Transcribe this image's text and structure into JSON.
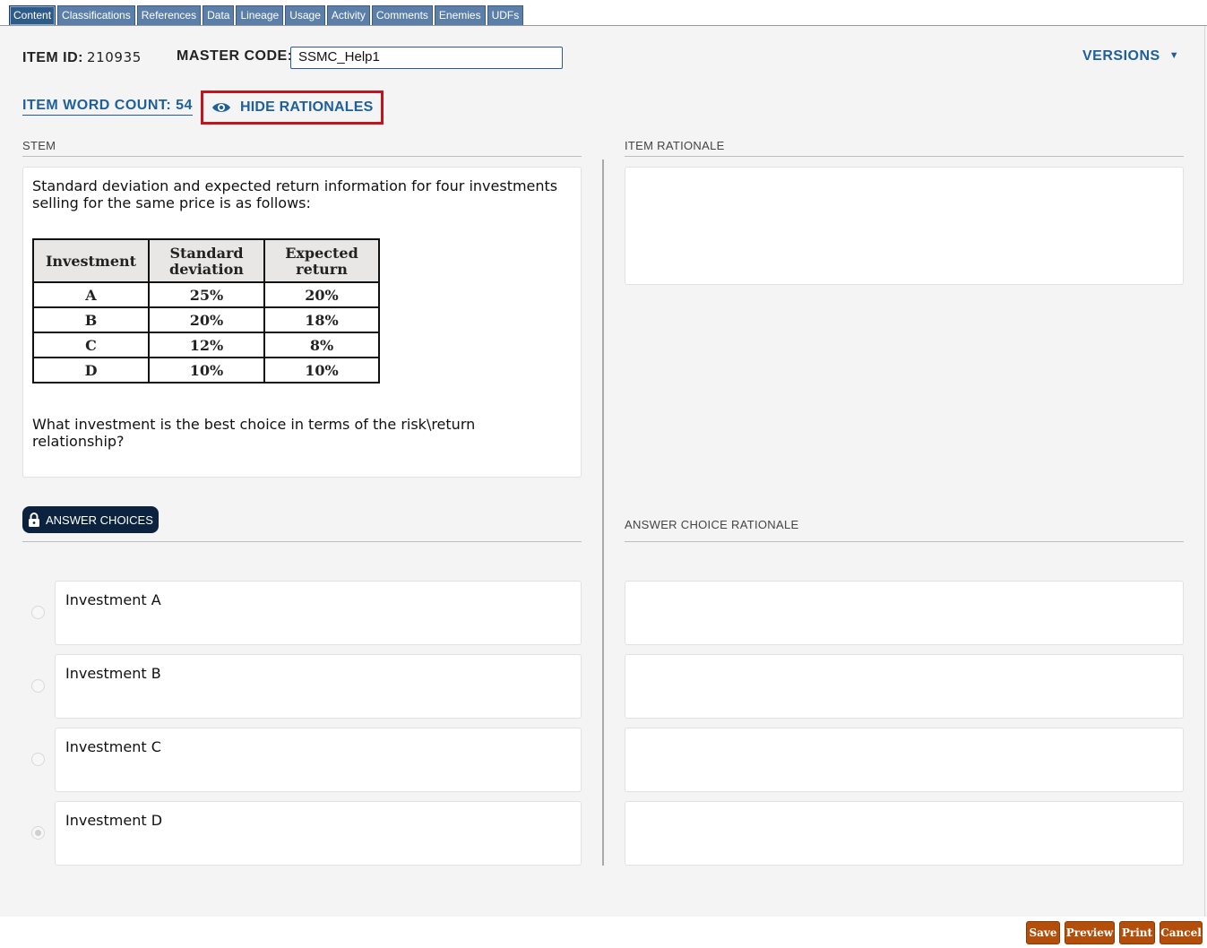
{
  "tabs": [
    "Content",
    "Classifications",
    "References",
    "Data",
    "Lineage",
    "Usage",
    "Activity",
    "Comments",
    "Enemies",
    "UDFs"
  ],
  "header": {
    "item_id_label": "ITEM ID:",
    "item_id_value": "210935",
    "master_code_label": "MASTER CODE:",
    "master_code_value": "SSMC_Help1",
    "versions_label": "VERSIONS",
    "word_count_label": "ITEM WORD COUNT: 54",
    "hide_rationales_label": "HIDE RATIONALES"
  },
  "stem": {
    "section_label": "STEM",
    "intro": "Standard deviation and expected return information for four investments selling for the same price is as follows:",
    "table": {
      "headers": [
        "Investment",
        "Standard deviation",
        "Expected return"
      ],
      "rows": [
        [
          "A",
          "25%",
          "20%"
        ],
        [
          "B",
          "20%",
          "18%"
        ],
        [
          "C",
          "12%",
          "8%"
        ],
        [
          "D",
          "10%",
          "10%"
        ]
      ]
    },
    "question": "What investment is the best choice in terms of the risk\\return relationship?"
  },
  "item_rationale": {
    "section_label": "ITEM RATIONALE"
  },
  "answers": {
    "label": "ANSWER CHOICES",
    "rationale_label": "ANSWER CHOICE RATIONALE",
    "choices": [
      "Investment A",
      "Investment B",
      "Investment C",
      "Investment D"
    ],
    "selected_index": 3
  },
  "footer": {
    "save": "Save",
    "preview": "Preview",
    "print": "Print",
    "cancel": "Cancel"
  },
  "colors": {
    "tab": "#5b7fa8",
    "link": "#1f5f9a",
    "highlight": "#c0141e",
    "button": "#b34f0b",
    "pill": "#0c2340"
  }
}
